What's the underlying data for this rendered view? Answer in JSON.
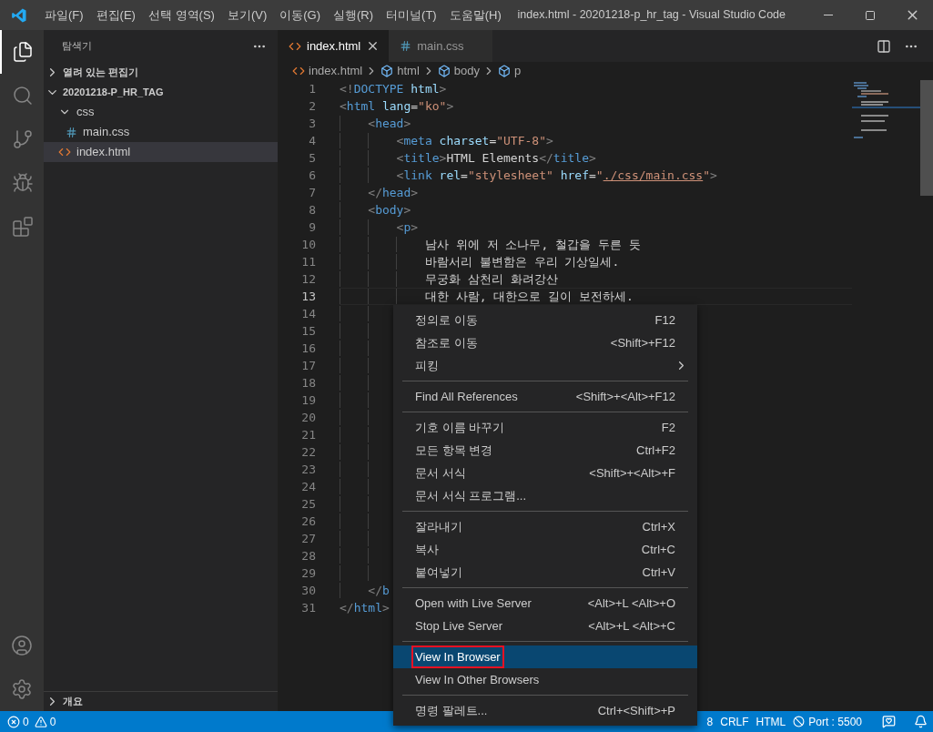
{
  "title_bar": {
    "menus": [
      "파일(F)",
      "편집(E)",
      "선택 영역(S)",
      "보기(V)",
      "이동(G)",
      "실행(R)",
      "터미널(T)",
      "도움말(H)"
    ],
    "title": "index.html - 20201218-p_hr_tag - Visual Studio Code"
  },
  "activity_bar": {
    "items": [
      {
        "kind": "files",
        "selected": true
      },
      {
        "kind": "search",
        "selected": false
      },
      {
        "kind": "git",
        "selected": false
      },
      {
        "kind": "debug",
        "selected": false
      },
      {
        "kind": "extensions",
        "selected": false
      }
    ],
    "bottom": [
      {
        "kind": "account"
      },
      {
        "kind": "settings"
      }
    ]
  },
  "sidebar": {
    "title": "탐색기",
    "sections": [
      {
        "label": "열려 있는 편집기",
        "expanded": false
      },
      {
        "label": "20201218-P_HR_TAG",
        "expanded": true
      }
    ],
    "tree": [
      {
        "label": "css",
        "kind": "folder",
        "expanded": true,
        "selected": false,
        "children": [
          {
            "label": "main.css",
            "kind": "css",
            "selected": false
          }
        ]
      },
      {
        "label": "index.html",
        "kind": "html",
        "selected": true
      }
    ],
    "outline": {
      "label": "개요",
      "expanded": false
    }
  },
  "tabs": [
    {
      "label": "index.html",
      "kind": "html",
      "selected": true
    },
    {
      "label": "main.css",
      "kind": "css",
      "selected": false
    }
  ],
  "breadcrumb": [
    {
      "label": "index.html",
      "kind": "html"
    },
    {
      "label": "html",
      "kind": "symbol"
    },
    {
      "label": "body",
      "kind": "symbol"
    },
    {
      "label": "p",
      "kind": "symbol"
    }
  ],
  "editor": {
    "lines": [
      {
        "number": "1",
        "current": false,
        "tokens": [
          {
            "t": "<!",
            "color": "#808080"
          },
          {
            "t": "DOCTYPE",
            "color": "#569cd6"
          },
          {
            "t": " html",
            "color": "#9cdcfe"
          },
          {
            "t": ">",
            "color": "#808080"
          }
        ]
      },
      {
        "number": "2",
        "current": false,
        "tokens": [
          {
            "t": "<",
            "color": "#808080"
          },
          {
            "t": "html",
            "color": "#569cd6"
          },
          {
            "t": " lang",
            "color": "#9cdcfe"
          },
          {
            "t": "=",
            "color": "#d4d4d4"
          },
          {
            "t": "\"ko\"",
            "color": "#ce9178"
          },
          {
            "t": ">",
            "color": "#808080"
          }
        ]
      },
      {
        "number": "3",
        "current": false,
        "tokens": [
          {
            "t": "    <",
            "color": "#808080"
          },
          {
            "t": "head",
            "color": "#569cd6"
          },
          {
            "t": ">",
            "color": "#808080"
          }
        ]
      },
      {
        "number": "4",
        "current": false,
        "tokens": [
          {
            "t": "        <",
            "color": "#808080"
          },
          {
            "t": "meta",
            "color": "#569cd6"
          },
          {
            "t": " charset",
            "color": "#9cdcfe"
          },
          {
            "t": "=",
            "color": "#d4d4d4"
          },
          {
            "t": "\"UTF-8\"",
            "color": "#ce9178"
          },
          {
            "t": ">",
            "color": "#808080"
          }
        ]
      },
      {
        "number": "5",
        "current": false,
        "tokens": [
          {
            "t": "        <",
            "color": "#808080"
          },
          {
            "t": "title",
            "color": "#569cd6"
          },
          {
            "t": ">",
            "color": "#808080"
          },
          {
            "t": "HTML Elements",
            "color": "#d4d4d4"
          },
          {
            "t": "</",
            "color": "#808080"
          },
          {
            "t": "title",
            "color": "#569cd6"
          },
          {
            "t": ">",
            "color": "#808080"
          }
        ]
      },
      {
        "number": "6",
        "current": false,
        "tokens": [
          {
            "t": "        <",
            "color": "#808080",
            "underline": false
          },
          {
            "t": "link",
            "color": "#569cd6",
            "underline": false
          },
          {
            "t": " rel",
            "color": "#9cdcfe",
            "underline": false
          },
          {
            "t": "=",
            "color": "#d4d4d4",
            "underline": false
          },
          {
            "t": "\"stylesheet\"",
            "color": "#ce9178",
            "underline": false
          },
          {
            "t": " href",
            "color": "#9cdcfe",
            "underline": false
          },
          {
            "t": "=",
            "color": "#d4d4d4",
            "underline": false
          },
          {
            "t": "\"",
            "color": "#ce9178",
            "underline": false
          },
          {
            "t": "./css/main.css",
            "color": "#ce9178",
            "underline": true
          },
          {
            "t": "\"",
            "color": "#ce9178",
            "underline": false
          },
          {
            "t": ">",
            "color": "#808080",
            "underline": false
          }
        ]
      },
      {
        "number": "7",
        "current": false,
        "tokens": [
          {
            "t": "    </",
            "color": "#808080"
          },
          {
            "t": "head",
            "color": "#569cd6"
          },
          {
            "t": ">",
            "color": "#808080"
          }
        ]
      },
      {
        "number": "8",
        "current": false,
        "tokens": [
          {
            "t": "    <",
            "color": "#808080"
          },
          {
            "t": "body",
            "color": "#569cd6"
          },
          {
            "t": ">",
            "color": "#808080"
          }
        ]
      },
      {
        "number": "9",
        "current": false,
        "tokens": [
          {
            "t": "        <",
            "color": "#808080"
          },
          {
            "t": "p",
            "color": "#569cd6"
          },
          {
            "t": ">",
            "color": "#808080"
          }
        ]
      },
      {
        "number": "10",
        "current": false,
        "tokens": [
          {
            "t": "            남사 위에 저 소나무, 철갑을 두른 듯",
            "color": "#d4d4d4"
          }
        ]
      },
      {
        "number": "11",
        "current": false,
        "tokens": [
          {
            "t": "            바람서리 불변함은 우리 기상일세.",
            "color": "#d4d4d4"
          }
        ]
      },
      {
        "number": "12",
        "current": false,
        "tokens": [
          {
            "t": "            무궁화 삼천리 화려강산",
            "color": "#d4d4d4"
          }
        ]
      },
      {
        "number": "13",
        "current": true,
        "tokens": [
          {
            "t": "            대한 사람, 대한으로 길이 보전하세.",
            "color": "#d4d4d4"
          }
        ]
      },
      {
        "number": "14",
        "current": false
      },
      {
        "number": "15",
        "current": false
      },
      {
        "number": "16",
        "current": false
      },
      {
        "number": "17",
        "current": false
      },
      {
        "number": "18",
        "current": false
      },
      {
        "number": "19",
        "current": false
      },
      {
        "number": "20",
        "current": false
      },
      {
        "number": "21",
        "current": false
      },
      {
        "number": "22",
        "current": false
      },
      {
        "number": "23",
        "current": false
      },
      {
        "number": "24",
        "current": false
      },
      {
        "number": "25",
        "current": false
      },
      {
        "number": "26",
        "current": false
      },
      {
        "number": "27",
        "current": false
      },
      {
        "number": "28",
        "current": false
      },
      {
        "number": "29",
        "current": false
      },
      {
        "number": "30",
        "current": false,
        "tokens": [
          {
            "t": "    </",
            "color": "#808080"
          },
          {
            "t": "b",
            "color": "#569cd6"
          }
        ]
      },
      {
        "number": "31",
        "current": false,
        "tokens": [
          {
            "t": "</",
            "color": "#808080"
          },
          {
            "t": "html",
            "color": "#569cd6"
          },
          {
            "t": ">",
            "color": "#808080"
          }
        ]
      }
    ]
  },
  "context_menu": {
    "items": [
      {
        "kind": "item",
        "label": "정의로 이동",
        "shortcut": "F12",
        "submenu": false,
        "selected": false,
        "outlined": false
      },
      {
        "kind": "item",
        "label": "참조로 이동",
        "shortcut": "<Shift>+F12",
        "submenu": false,
        "selected": false,
        "outlined": false
      },
      {
        "kind": "item",
        "label": "피킹",
        "submenu": true,
        "selected": false,
        "outlined": false
      },
      {
        "kind": "separator"
      },
      {
        "kind": "item",
        "label": "Find All References",
        "shortcut": "<Shift>+<Alt>+F12",
        "submenu": false,
        "selected": false,
        "outlined": false
      },
      {
        "kind": "separator"
      },
      {
        "kind": "item",
        "label": "기호 이름 바꾸기",
        "shortcut": "F2",
        "submenu": false,
        "selected": false,
        "outlined": false
      },
      {
        "kind": "item",
        "label": "모든 항목 변경",
        "shortcut": "Ctrl+F2",
        "submenu": false,
        "selected": false,
        "outlined": false
      },
      {
        "kind": "item",
        "label": "문서 서식",
        "shortcut": "<Shift>+<Alt>+F",
        "submenu": false,
        "selected": false,
        "outlined": false
      },
      {
        "kind": "item",
        "label": "문서 서식 프로그램...",
        "submenu": false,
        "selected": false,
        "outlined": false
      },
      {
        "kind": "separator"
      },
      {
        "kind": "item",
        "label": "잘라내기",
        "shortcut": "Ctrl+X",
        "submenu": false,
        "selected": false,
        "outlined": false
      },
      {
        "kind": "item",
        "label": "복사",
        "shortcut": "Ctrl+C",
        "submenu": false,
        "selected": false,
        "outlined": false
      },
      {
        "kind": "item",
        "label": "붙여넣기",
        "shortcut": "Ctrl+V",
        "submenu": false,
        "selected": false,
        "outlined": false
      },
      {
        "kind": "separator"
      },
      {
        "kind": "item",
        "label": "Open with Live Server",
        "shortcut": "<Alt>+L <Alt>+O",
        "submenu": false,
        "selected": false,
        "outlined": false
      },
      {
        "kind": "item",
        "label": "Stop Live Server",
        "shortcut": "<Alt>+L <Alt>+C",
        "submenu": false,
        "selected": false,
        "outlined": false
      },
      {
        "kind": "separator"
      },
      {
        "kind": "item",
        "label": "View In Browser",
        "submenu": false,
        "selected": true,
        "outlined": true
      },
      {
        "kind": "item",
        "label": "View In Other Browsers",
        "submenu": false,
        "selected": false,
        "outlined": false
      },
      {
        "kind": "separator"
      },
      {
        "kind": "item",
        "label": "명령 팔레트...",
        "shortcut": "Ctrl+<Shift>+P",
        "submenu": false,
        "selected": false,
        "outlined": false
      }
    ]
  },
  "status_bar": {
    "errors": "0",
    "warnings": "0",
    "right": [
      {
        "kind": "text",
        "label": "8"
      },
      {
        "kind": "text",
        "label": "CRLF"
      },
      {
        "kind": "text",
        "label": "HTML"
      },
      {
        "kind": "port",
        "label": "Port : 5500"
      },
      {
        "kind": "feedback"
      },
      {
        "kind": "bell"
      }
    ]
  }
}
